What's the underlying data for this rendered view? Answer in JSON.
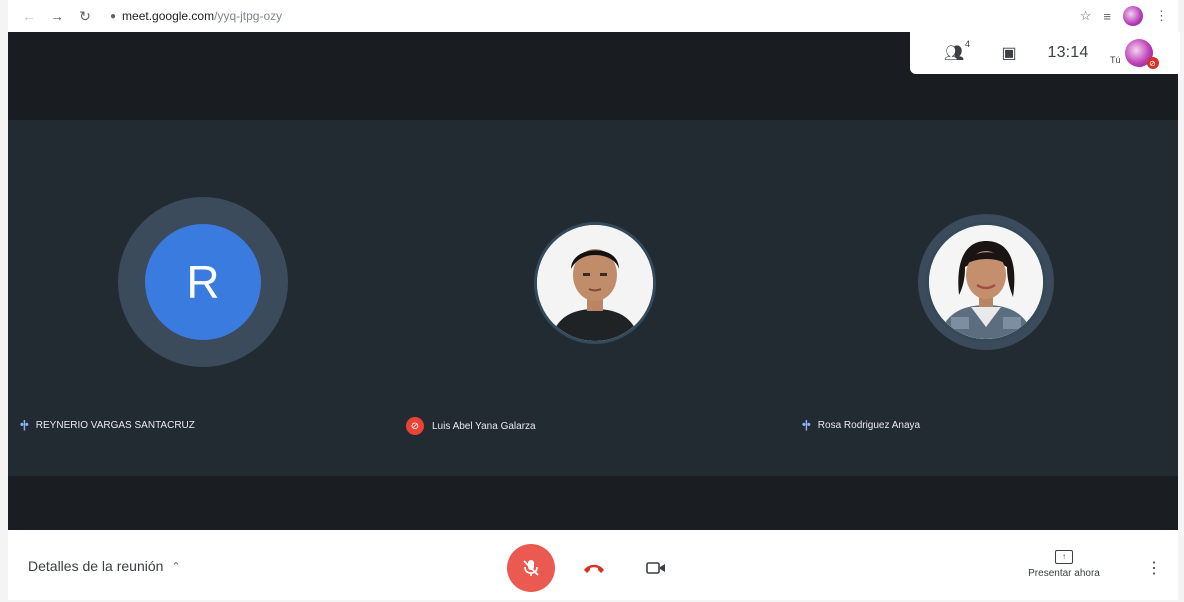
{
  "browser": {
    "url_host": "meet.google.com",
    "url_path": "/yyq-jtpg-ozy"
  },
  "meet": {
    "participant_count": "4",
    "clock": "13:14",
    "me_label": "Tú"
  },
  "participants": [
    {
      "name": "REYNERIO VARGAS SANTACRUZ",
      "initial": "R",
      "status": "speaking"
    },
    {
      "name": "Luis Abel Yana Galarza",
      "status": "muted"
    },
    {
      "name": "Rosa Rodriguez Anaya",
      "status": "speaking"
    }
  ],
  "bottom": {
    "details_label": "Detalles de la reunión",
    "present_label": "Presentar ahora"
  },
  "colors": {
    "stage_bg": "#222a32",
    "avatar_blue": "#3a7be0",
    "mute_red": "#ea4335"
  },
  "icons": {
    "back": "arrow-left-icon",
    "forward": "arrow-right-icon",
    "reload": "reload-icon",
    "star": "star-icon",
    "mic_off": "mic-off-icon",
    "hangup": "hangup-icon",
    "camera": "camera-icon"
  }
}
